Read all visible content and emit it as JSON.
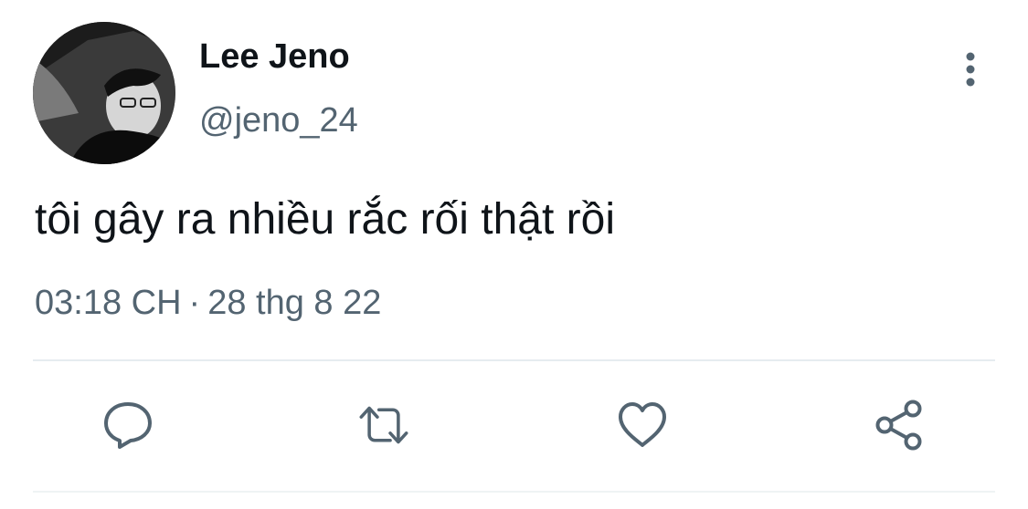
{
  "tweet": {
    "author": {
      "display_name": "Lee Jeno",
      "handle": "@jeno_24",
      "avatar_icon": "profile-photo"
    },
    "text": "tôi gây ra nhiều rắc rối thật rồi",
    "time": "03:18 CH",
    "separator": "·",
    "date": "28 thg 8 22",
    "menu_icon": "more-vertical-icon",
    "actions": [
      {
        "name": "reply",
        "icon": "reply-icon"
      },
      {
        "name": "retweet",
        "icon": "retweet-icon"
      },
      {
        "name": "like",
        "icon": "heart-icon"
      },
      {
        "name": "share",
        "icon": "share-icon"
      }
    ]
  },
  "colors": {
    "primary_text": "#0f1419",
    "secondary_text": "#536471",
    "divider": "#e6ecf0"
  }
}
